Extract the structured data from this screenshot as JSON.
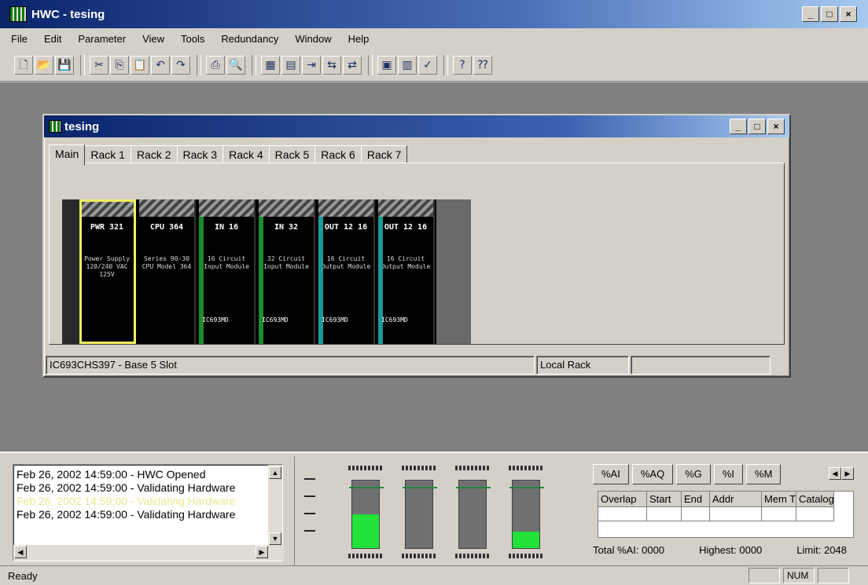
{
  "app": {
    "title": "HWC - tesing"
  },
  "menu": [
    "File",
    "Edit",
    "Parameter",
    "View",
    "Tools",
    "Redundancy",
    "Window",
    "Help"
  ],
  "toolbar_icons": [
    "new-icon",
    "open-icon",
    "save-icon",
    "cut-icon",
    "copy-icon",
    "paste-icon",
    "undo-icon",
    "redo-icon",
    "print-icon",
    "print-preview-icon",
    "cpu-icon",
    "module-icon",
    "insert-icon",
    "redundancy-a-icon",
    "redundancy-b-icon",
    "reference-icon",
    "report-icon",
    "verify-icon",
    "help-icon",
    "context-help-icon"
  ],
  "child": {
    "title": "tesing",
    "tabs": [
      "Main",
      "Rack 1",
      "Rack 2",
      "Rack 3",
      "Rack 4",
      "Rack 5",
      "Rack 6",
      "Rack 7"
    ],
    "active_tab": 0,
    "slots": [
      {
        "label": "PWR 321",
        "desc": "Power Supply 120/240 VAC 125V",
        "cat": "",
        "stripe": "",
        "selected": true
      },
      {
        "label": "CPU 364",
        "desc": "Series 90-30 CPU Model 364",
        "cat": "",
        "stripe": "",
        "selected": false
      },
      {
        "label": "IN 16",
        "desc": "16 Circuit Input Module",
        "cat": "IC693MD",
        "stripe": "#1e8a2e",
        "selected": false
      },
      {
        "label": "IN 32",
        "desc": "32 Circuit Input Module",
        "cat": "IC693MD",
        "stripe": "#1e8a2e",
        "selected": false
      },
      {
        "label": "OUT 12 16",
        "desc": "16 Circuit Output Module",
        "cat": "IC693MD",
        "stripe": "#1a9a9a",
        "selected": false
      },
      {
        "label": "OUT 12 16",
        "desc": "16 Circuit Output Module",
        "cat": "IC693MD",
        "stripe": "#1a9a9a",
        "selected": false
      }
    ],
    "status": [
      "IC693CHS397 - Base 5 Slot",
      "Local Rack",
      ""
    ]
  },
  "log": {
    "lines": [
      {
        "text": "Feb 26, 2002 14:59:00 - HWC Opened",
        "color": "#000000"
      },
      {
        "text": "Feb 26, 2002 14:59:00 - Validating Hardware",
        "color": "#000000"
      },
      {
        "text": "Feb 26, 2002 14:59:00 - Validating Hardware",
        "color": "#e8e890"
      },
      {
        "text": "Feb 26, 2002 14:59:00 - Validating Hardware",
        "color": "#000000"
      }
    ]
  },
  "gauges": [
    {
      "fill": 0.5
    },
    {
      "fill": 0
    },
    {
      "fill": 0
    },
    {
      "fill": 0.25
    }
  ],
  "refview": {
    "tabs": [
      "%AI",
      "%AQ",
      "%G",
      "%I",
      "%M"
    ],
    "columns": [
      "Overlap",
      "Start",
      "End",
      "Addr",
      "Mem T",
      "Catalog"
    ],
    "footer": {
      "total": "Total %AI: 0000",
      "highest": "Highest: 0000",
      "limit": "Limit: 2048"
    }
  },
  "statusbar": {
    "text": "Ready",
    "panels": [
      "",
      "NUM",
      ""
    ]
  },
  "colors": {
    "title_gradient_start": "#0a246a",
    "gauge_fill": "#22e23a",
    "selected_slot": "#f0f060"
  }
}
